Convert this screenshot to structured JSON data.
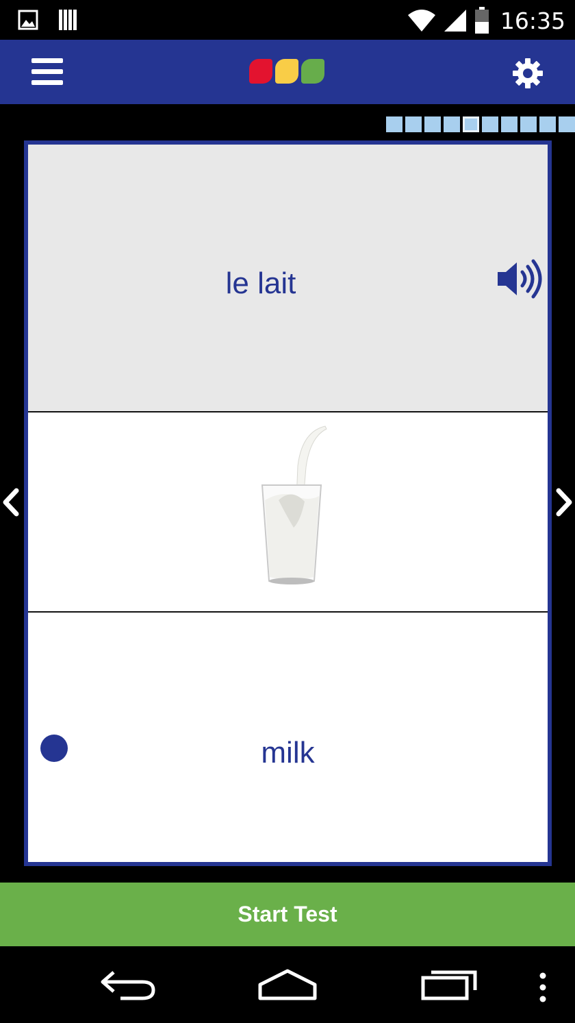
{
  "status_bar": {
    "time": "16:35",
    "icons": [
      "image-icon",
      "storage-icon",
      "wifi-icon",
      "signal-icon",
      "battery-icon"
    ]
  },
  "app_bar": {
    "menu_icon": "hamburger-menu-icon",
    "settings_icon": "gear-icon",
    "logo_colors": [
      "#e3132f",
      "#f9cd47",
      "#67ad4b"
    ]
  },
  "progress": {
    "total": 10,
    "current": 5
  },
  "card": {
    "word": "le lait",
    "speaker_icon": "speaker-icon",
    "image_icon": "glass-of-milk-image",
    "translation": "milk"
  },
  "nav": {
    "prev_icon": "chevron-left-icon",
    "next_icon": "chevron-right-icon"
  },
  "actions": {
    "start_test_label": "Start Test"
  },
  "system_nav": {
    "icons": [
      "back-icon",
      "home-icon",
      "recents-icon",
      "overflow-menu-icon"
    ]
  },
  "colors": {
    "brand_blue": "#253592",
    "start_green": "#6ab04a",
    "progress_blue": "#a8cfee"
  }
}
